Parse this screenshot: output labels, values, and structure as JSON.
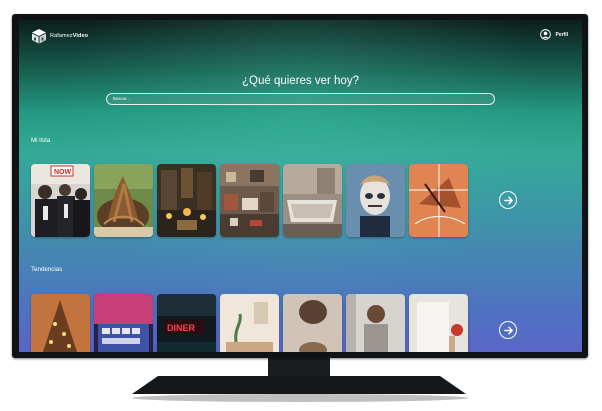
{
  "app": {
    "logo_text_light": "Rafamez",
    "logo_text_bold": "Video",
    "profile_label": "Perfil"
  },
  "hero": {
    "headline": "¿Qué quieres ver hoy?",
    "search_placeholder": "Buscar..."
  },
  "sections": [
    {
      "title": "Mi lista",
      "items": [
        {
          "icon": "protest-photo"
        },
        {
          "icon": "roots-photo"
        },
        {
          "icon": "altar-photo"
        },
        {
          "icon": "cluttered-room-photo"
        },
        {
          "icon": "old-bathtub-photo"
        },
        {
          "icon": "painted-face-photo"
        },
        {
          "icon": "court-lines-photo"
        }
      ]
    },
    {
      "title": "Tendencias",
      "items": [
        {
          "icon": "christmas-tree-photo"
        },
        {
          "icon": "keyboard-photo"
        },
        {
          "icon": "neon-sign-photo"
        },
        {
          "icon": "interior-photo"
        },
        {
          "icon": "pottery-photo"
        },
        {
          "icon": "person-photo"
        },
        {
          "icon": "apple-photo"
        }
      ]
    }
  ],
  "colors": {
    "screen_top": "#0c1e1a",
    "screen_mid": "#249a82",
    "screen_bottom": "#5a66c6",
    "text": "#ffffff"
  }
}
